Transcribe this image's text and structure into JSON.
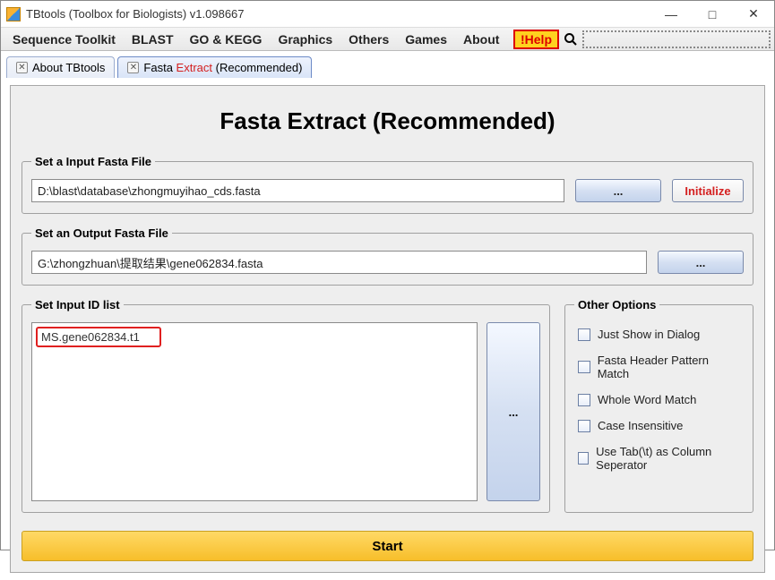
{
  "window": {
    "title": "TBtools (Toolbox for Biologists) v1.098667",
    "minimize": "—",
    "maximize": "□",
    "close": "✕"
  },
  "menubar": {
    "items": [
      "Sequence Toolkit",
      "BLAST",
      "GO & KEGG",
      "Graphics",
      "Others",
      "Games",
      "About"
    ],
    "help": "!Help"
  },
  "tabs": [
    {
      "label": "About TBtools",
      "close": "✕"
    },
    {
      "prefix": "Fasta ",
      "extract": "Extract",
      "suffix": " (Recommended)",
      "close": "✕"
    }
  ],
  "page": {
    "title": "Fasta Extract (Recommended)"
  },
  "input_fasta": {
    "legend": "Set a Input Fasta File",
    "value": "D:\\blast\\database\\zhongmuyihao_cds.fasta",
    "browse": "...",
    "initialize": "Initialize"
  },
  "output_fasta": {
    "legend": "Set an Output Fasta File",
    "value": "G:\\zhongzhuan\\提取结果\\gene062834.fasta",
    "browse": "..."
  },
  "id_list": {
    "legend": "Set Input ID list",
    "value": "MS.gene062834.t1",
    "browse": "..."
  },
  "options": {
    "legend": "Other Options",
    "items": [
      "Just Show in Dialog",
      "Fasta Header Pattern Match",
      "Whole Word Match",
      "Case Insensitive",
      "Use Tab(\\t) as Column Seperator"
    ]
  },
  "start": "Start"
}
